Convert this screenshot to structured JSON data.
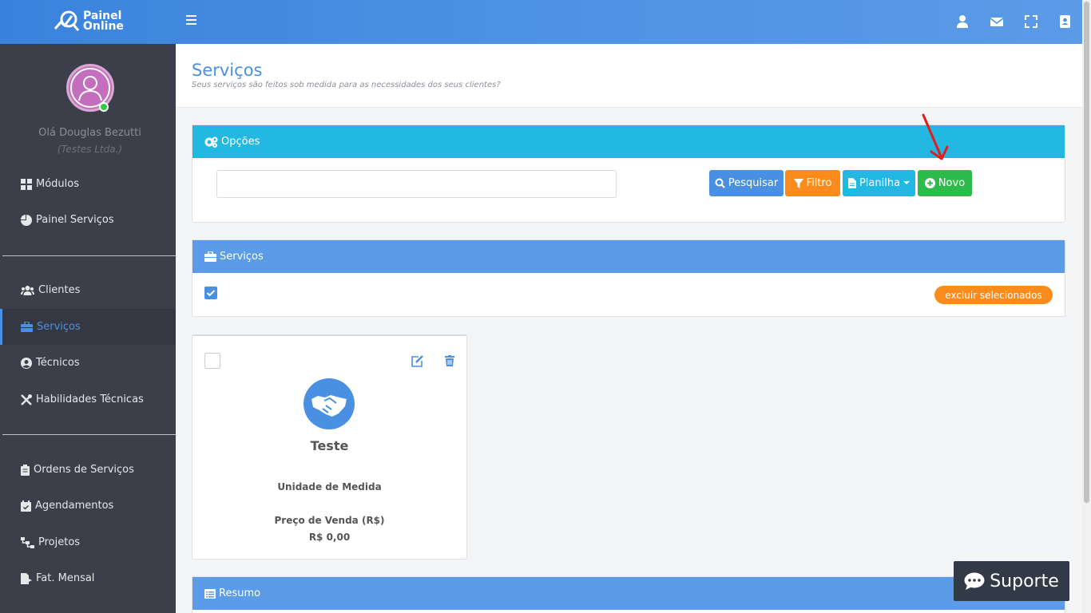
{
  "app": {
    "logo_line1": "Painel",
    "logo_line2": "Online"
  },
  "colors": {
    "brand": "#4a90e2",
    "info": "#22b8e2",
    "warning": "#fb8c1c",
    "success": "#2dbb4b",
    "sidebar": "#3c3f4a"
  },
  "user": {
    "greeting": "Olá Douglas Bezutti",
    "company": "(Testes Ltda.)"
  },
  "topbar_icons": [
    "user-icon",
    "envelope-icon",
    "expand-icon",
    "address-book-icon"
  ],
  "sidebar": {
    "items": [
      {
        "label": "Módulos",
        "icon": "grid-icon"
      },
      {
        "label": "Painel Serviços",
        "icon": "pie-chart-icon"
      },
      {
        "label": "Clientes",
        "icon": "users-icon"
      },
      {
        "label": "Serviços",
        "icon": "briefcase-icon",
        "active": true
      },
      {
        "label": "Técnicos",
        "icon": "user-circle-icon"
      },
      {
        "label": "Habilidades Técnicas",
        "icon": "tools-icon"
      },
      {
        "label": "Ordens de Serviços",
        "icon": "clipboard-icon"
      },
      {
        "label": "Agendamentos",
        "icon": "calendar-check-icon"
      },
      {
        "label": "Projetos",
        "icon": "sitemap-icon"
      },
      {
        "label": "Fat. Mensal",
        "icon": "file-export-icon"
      }
    ]
  },
  "page": {
    "title": "Serviços",
    "subtitle": "Seus serviços são feitos sob medida para as necessidades dos seus clientes?"
  },
  "options_panel": {
    "title": "Opções",
    "search_value": "",
    "buttons": {
      "search": "Pesquisar",
      "filter": "Filtro",
      "sheet": "Planilha",
      "new": "Novo"
    }
  },
  "services_panel": {
    "title": "Serviços",
    "select_all_checked": true,
    "delete_selected": "excluir selecionados"
  },
  "service_card": {
    "name": "Teste",
    "unit_label": "Unidade de Medida",
    "unit_value": "",
    "price_label": "Preço de Venda (R$)",
    "price_value": "R$ 0,00"
  },
  "summary_panel": {
    "title": "Resumo"
  },
  "support": {
    "label": "Suporte"
  }
}
